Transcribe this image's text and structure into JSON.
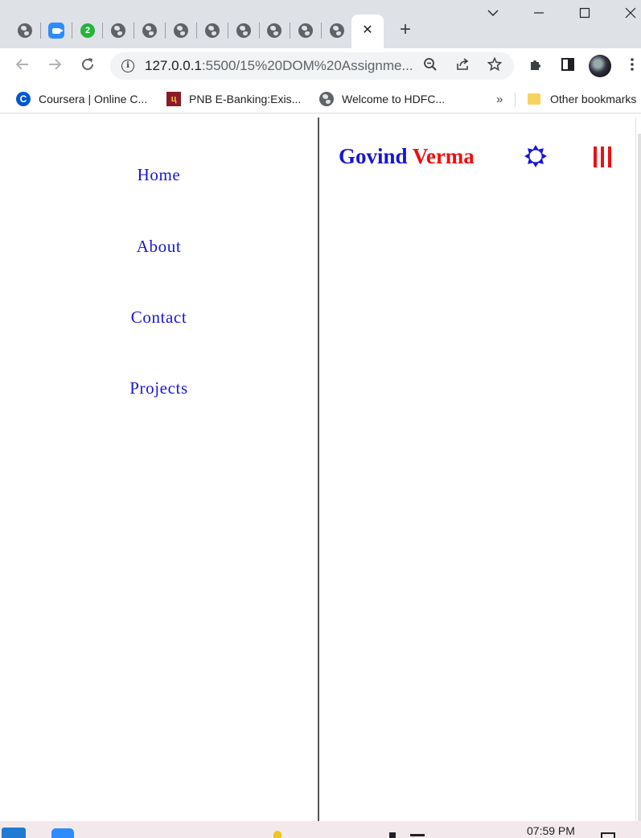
{
  "browser": {
    "tabs": [
      {
        "icon": "globe-icon"
      },
      {
        "icon": "zoom-icon"
      },
      {
        "icon": "notification-icon",
        "badge": "2"
      },
      {
        "icon": "globe-icon"
      },
      {
        "icon": "globe-icon"
      },
      {
        "icon": "globe-icon"
      },
      {
        "icon": "globe-icon"
      },
      {
        "icon": "globe-icon"
      },
      {
        "icon": "globe-icon"
      },
      {
        "icon": "globe-icon"
      },
      {
        "icon": "globe-icon"
      }
    ],
    "active_tab_close": "✕",
    "new_tab": "+",
    "url_host": "127.0.0.1",
    "url_rest": ":5500/15%20DOM%20Assignme..."
  },
  "bookmarks": {
    "items": [
      {
        "icon": "coursera-icon",
        "label": "Coursera | Online C..."
      },
      {
        "icon": "pnb-icon",
        "label": "PNB E-Banking:Exis..."
      },
      {
        "icon": "globe-icon",
        "label": "Welcome to HDFC..."
      }
    ],
    "overflow": "»",
    "other": "Other bookmarks"
  },
  "page": {
    "nav": [
      "Home",
      "About",
      "Contact",
      "Projects"
    ],
    "brand_first": "Govind",
    "brand_last": "Verma",
    "colors": {
      "nav": "#1a16d8",
      "brand_first": "#1515d6",
      "brand_last": "#ef0f0f",
      "theme_icon": "#1515d6",
      "menu_icon": "#ef0f0f"
    },
    "theme_toggle_icon": "sun-icon",
    "menu_icon": "hamburger-menu-icon"
  },
  "taskbar": {
    "time": "07:59 PM"
  }
}
